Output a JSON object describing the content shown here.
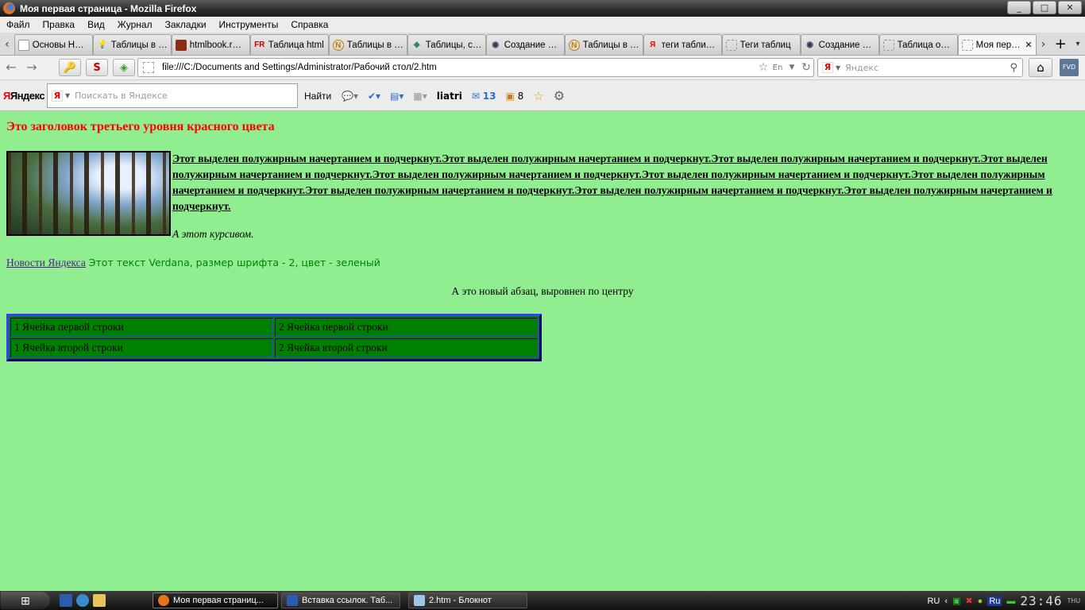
{
  "window": {
    "title": "Моя первая страница - Mozilla Firefox",
    "controls": [
      "_",
      "□",
      "✕"
    ]
  },
  "menu": [
    "Файл",
    "Правка",
    "Вид",
    "Журнал",
    "Закладки",
    "Инструменты",
    "Справка"
  ],
  "tabs": [
    {
      "label": "Основы HTM...",
      "icon": "page-icon"
    },
    {
      "label": "Таблицы в Н...",
      "icon": "bulb-icon"
    },
    {
      "label": "htmlbook.ru -...",
      "icon": "htmlbook-icon"
    },
    {
      "label": "Таблица html",
      "icon": "fr-icon"
    },
    {
      "label": "Таблицы в Н...",
      "icon": "n-icon"
    },
    {
      "label": "Таблицы, ст...",
      "icon": "diamond-icon"
    },
    {
      "label": "Создание та...",
      "icon": "eye-icon"
    },
    {
      "label": "Таблицы в Н...",
      "icon": "n-icon"
    },
    {
      "label": "теги таблиц...",
      "icon": "yandex-icon"
    },
    {
      "label": "Теги таблиц",
      "icon": "blank-icon"
    },
    {
      "label": "Создание та...",
      "icon": "eye-icon"
    },
    {
      "label": "Таблица осн...",
      "icon": "blank-icon"
    },
    {
      "label": "Моя перв...",
      "icon": "blank-icon",
      "active": true
    }
  ],
  "nav": {
    "url": "file:///C:/Documents and Settings/Administrator/Рабочий стол/2.htm",
    "search_placeholder": "Яндекс"
  },
  "yandex_bar": {
    "logo": "Яндекс",
    "search_placeholder": "Поискать в Яндексе",
    "find_label": "Найти",
    "user": "liatri",
    "mail_count": "13",
    "bookmarks_count": "8"
  },
  "page": {
    "heading": "Это заголовок третьего уровня красного цвета",
    "bold_underlined": "Этот выделен полужирным начертанием и подчеркнут.Этот выделен полужирным начертанием и подчеркнут.Этот выделен полужирным начертанием и подчеркнут.Этот выделен полужирным начертанием и подчеркнут.Этот выделен полужирным начертанием и подчеркнут.Этот выделен полужирным начертанием и подчеркнут.Этот выделен полужирным начертанием и подчеркнут.Этот выделен полужирным начертанием и подчеркнут.Этот выделен полужирным начертанием и подчеркнут.Этот выделен полужирным начертанием и подчеркнут.",
    "italic": "А этот курсивом.",
    "link": "Новости Яндекса",
    "verdana_text": " Этот текст Verdana, размер шрифта - 2, цвет - зеленый",
    "centered": "А это новый абзац, выровнен по центру",
    "table": [
      [
        "1 Ячейка первой строки",
        "2 Ячейка первой строки"
      ],
      [
        "1 Ячейка второй строки",
        "2 Ячейка второй строки"
      ]
    ],
    "colors": {
      "background": "#90ee90",
      "heading": "#ff0000",
      "table": "#008000",
      "verdana": "#008000"
    }
  },
  "taskbar": {
    "tasks": [
      {
        "label": "Моя первая страниц...",
        "active": true
      },
      {
        "label": "Вставка ссылок. Таб...",
        "active": false
      },
      {
        "label": "2.htm - Блокнот",
        "active": false
      }
    ],
    "lang": "RU",
    "tray_lang": "Ru",
    "time": "23:46",
    "day": "THU"
  }
}
